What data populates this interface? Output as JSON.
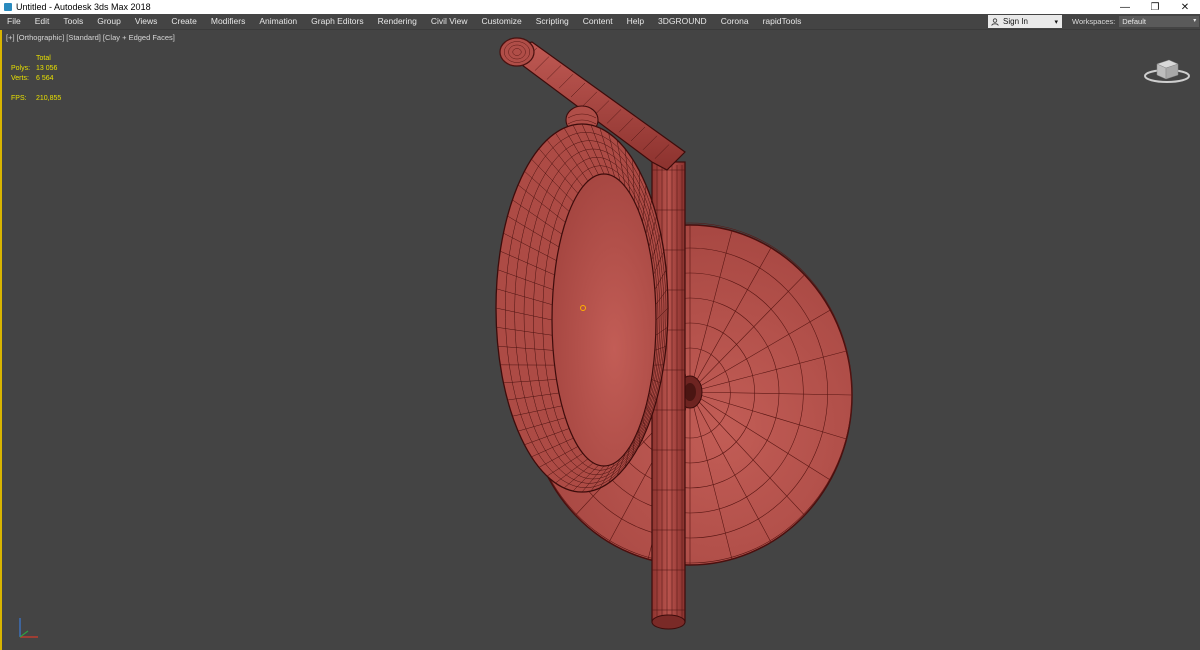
{
  "window": {
    "title": "Untitled - Autodesk 3ds Max 2018",
    "minimize": "—",
    "restore": "❐",
    "close": "✕"
  },
  "menu": [
    "File",
    "Edit",
    "Tools",
    "Group",
    "Views",
    "Create",
    "Modifiers",
    "Animation",
    "Graph Editors",
    "Rendering",
    "Civil View",
    "Customize",
    "Scripting",
    "Content",
    "Help",
    "3DGROUND",
    "Corona",
    "rapidTools"
  ],
  "account": {
    "sign_in": "Sign In",
    "caret": "▾"
  },
  "workspaces": {
    "label": "Workspaces:",
    "value": "Default",
    "caret": "▾"
  },
  "viewport": {
    "label": "[+] [Orthographic] [Standard] [Clay + Edged Faces]",
    "stats": {
      "header": "Total",
      "polys_label": "Polys:",
      "polys_value": "13 056",
      "verts_label": "Verts:",
      "verts_value": "6 564",
      "fps_label": "FPS:",
      "fps_value": "210,855"
    }
  },
  "colors": {
    "clay": "#b5524c",
    "edge": "#4a0f0e",
    "viewport_bg": "#444444",
    "active_border": "#d8b400",
    "stats_text": "#e8e000"
  }
}
